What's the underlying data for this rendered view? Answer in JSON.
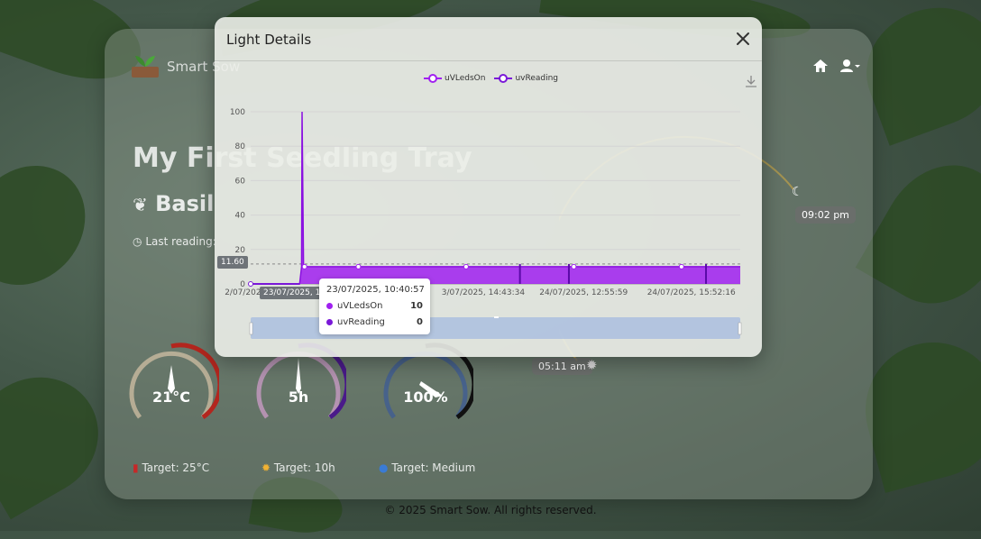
{
  "app": {
    "brand": "Smart Sow",
    "tray_title": "My First Seedling Tray",
    "plant": "Basil",
    "last_reading_label": "Last reading:",
    "footer": "© 2025 Smart Sow. All rights reserved.",
    "sunset_time": "09:02 pm",
    "sunrise_time": "05:11 am"
  },
  "gauges": [
    {
      "label": "temperature-gauge",
      "value": "21°C",
      "ticks": [
        "0",
        "10",
        "20",
        "30",
        "40"
      ],
      "color": "#b3261e"
    },
    {
      "label": "light-hours-gauge",
      "value": "5h",
      "ticks": [
        "0",
        "2.5",
        "5",
        "7.5",
        "10"
      ],
      "color": "#6a1b9a"
    },
    {
      "label": "humidity-gauge",
      "value": "100%",
      "ticks": [
        "0",
        "25",
        "50",
        "75",
        "100"
      ],
      "color": "#1a3a6e"
    }
  ],
  "targets": [
    {
      "text": "Target: 25°C"
    },
    {
      "text": "Target: 10h"
    },
    {
      "text": "Target: Medium"
    }
  ],
  "modal": {
    "title": "Light Details",
    "legend": [
      "uVLedsOn",
      "uvReading"
    ],
    "tooltip": {
      "time": "23/07/2025, 10:40:57",
      "rows": [
        {
          "name": "uVLedsOn",
          "value": "10",
          "color": "#a020f0"
        },
        {
          "name": "uvReading",
          "value": "0",
          "color": "#7a18d8"
        }
      ]
    },
    "axis_pointer_y": "11.60",
    "axis_pointer_x": "23/07/2025, 1"
  },
  "chart_data": {
    "type": "area",
    "y_ticks": [
      "0",
      "20",
      "40",
      "60",
      "80",
      "100"
    ],
    "ylim": [
      0,
      100
    ],
    "x_labels": [
      "2/07/2025, 1",
      "3/07/2025, 14:43:34",
      "24/07/2025, 12:55:59",
      "24/07/2025, 15:52:16"
    ],
    "series": [
      {
        "name": "uVLedsOn",
        "color": "#a020f0"
      },
      {
        "name": "uvReading",
        "color": "#7a18d8"
      }
    ],
    "points": [
      {
        "x": 0.0,
        "y": 0
      },
      {
        "x": 0.1,
        "y": 0
      },
      {
        "x": 0.104,
        "y": 10
      },
      {
        "x": 0.105,
        "y": 100
      },
      {
        "x": 0.108,
        "y": 10
      },
      {
        "x": 1.0,
        "y": 10
      }
    ],
    "markers_x": [
      0.11,
      0.22,
      0.44,
      0.66,
      0.88
    ],
    "spikes_x": [
      0.55,
      0.65,
      0.93
    ]
  }
}
